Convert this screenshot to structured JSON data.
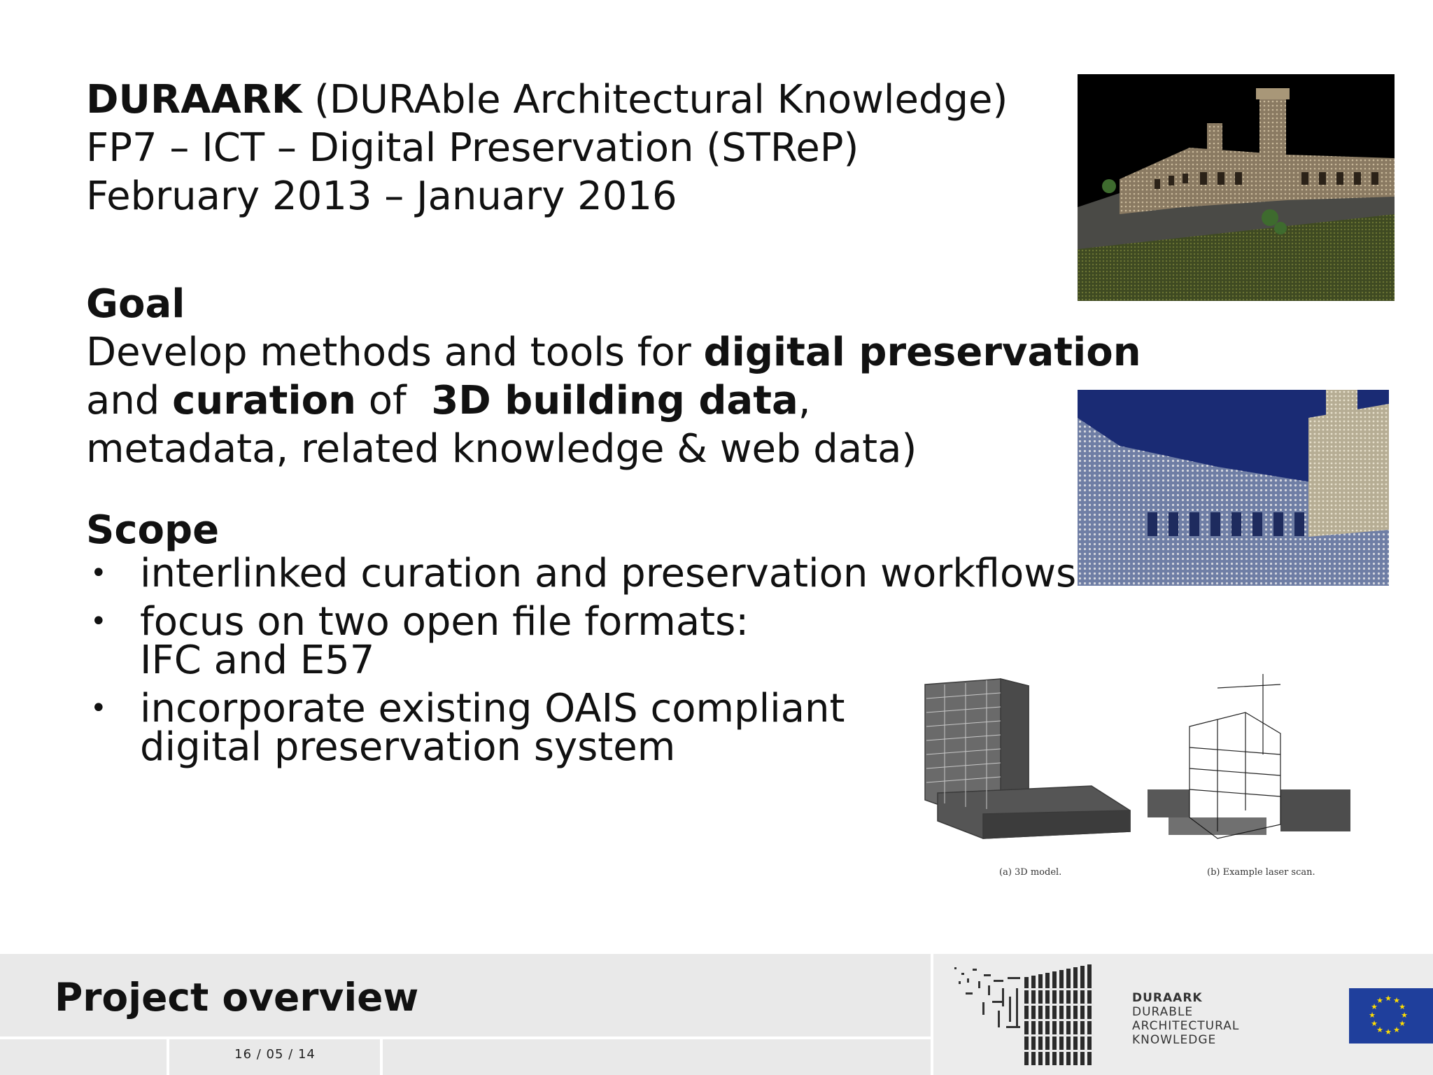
{
  "header": {
    "project_bold": "DURAARK",
    "project_rest": " (DURAble Architectural Knowledge)",
    "programme": "FP7 – ICT – Digital Preservation (STReP)",
    "period": "February 2013 – January 2016"
  },
  "goal": {
    "heading": "Goal",
    "line1_pre": "Develop methods and tools for ",
    "line1_bold": "digital preservation",
    "line2_pre": "and ",
    "line2_bold1": "curation",
    "line2_mid": " of  ",
    "line2_bold2": "3D building data",
    "line2_post": ",",
    "line3": "metadata, related knowledge & web data)"
  },
  "scope": {
    "heading": "Scope",
    "bullet": "•",
    "items": [
      {
        "line1": "interlinked curation and preservation workflows",
        "line2": ""
      },
      {
        "line1": "focus on two open file formats:",
        "line2": "IFC and E57"
      },
      {
        "line1": "incorporate existing OAIS compliant",
        "line2": "digital preservation system"
      }
    ]
  },
  "figures": {
    "caption_a": "(a) 3D model.",
    "caption_b": "(b) Example laser scan."
  },
  "footer": {
    "title": "Project overview",
    "date": "16 / 05 / 14",
    "logo_line1": "DURAARK",
    "logo_line2": "DURABLE",
    "logo_line3": "ARCHITECTURAL",
    "logo_line4": "KNOWLEDGE"
  },
  "colors": {
    "footer_bg": "#e9e9e9",
    "eu_blue": "#1f3f9c",
    "eu_star": "#ffdd00"
  }
}
